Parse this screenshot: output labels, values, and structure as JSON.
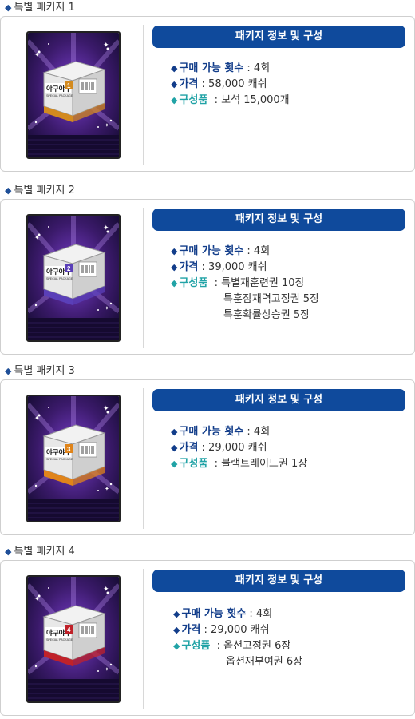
{
  "packages": [
    {
      "title": "특별 패키지 1",
      "header": "패키지 정보 및 구성",
      "count_label": "구매 가능 횟수",
      "count_value": ": 4회",
      "price_label": "가격",
      "price_value": ": 58,000 캐쉬",
      "items_label": "구성품",
      "items": [
        ": 보석 15,000개"
      ],
      "box_number": "1",
      "accent": "#d38a1f",
      "brand": "야구야구",
      "brand_sub": "SPECIAL PACKAGE"
    },
    {
      "title": "특별 패키지 2",
      "header": "패키지 정보 및 구성",
      "count_label": "구매 가능 횟수",
      "count_value": ": 4회",
      "price_label": "가격",
      "price_value": ": 39,000 캐쉬",
      "items_label": "구성품",
      "items": [
        ": 특별재훈련권 10장",
        "특훈잠재력고정권 5장",
        "특훈확률상승권 5장"
      ],
      "box_number": "2",
      "accent": "#5a3fb8",
      "brand": "야구야구",
      "brand_sub": "SPECIAL PACKAGE"
    },
    {
      "title": "특별 패키지 3",
      "header": "패키지 정보 및 구성",
      "count_label": "구매 가능 횟수",
      "count_value": ": 4회",
      "price_label": "가격",
      "price_value": ": 29,000 캐쉬",
      "items_label": "구성품",
      "items": [
        ": 블랙트레이드권 1장"
      ],
      "box_number": "3",
      "accent": "#e0841a",
      "brand": "야구야구",
      "brand_sub": "SPECIAL PACKAGE"
    },
    {
      "title": "특별 패키지 4",
      "header": "패키지 정보 및 구성",
      "count_label": "구매 가능 횟수",
      "count_value": ": 4회",
      "price_label": "가격",
      "price_value": ": 29,000 캐쉬",
      "items_label": "구성품",
      "items": [
        ": 옵션고정권 6장",
        "옵션재부여권 6장"
      ],
      "box_number": "4",
      "accent": "#c0222a",
      "brand": "야구야구",
      "brand_sub": "SPECIAL PACKAGE"
    }
  ],
  "colors": {
    "pill_bg": "#0f4a9c",
    "label_blue": "#123d8a",
    "label_teal": "#21a3a6",
    "card_bg_top": "#3b1a6b",
    "card_bg_bottom": "#1a0d3a"
  },
  "icons": {
    "bullet": "diamond-icon"
  }
}
